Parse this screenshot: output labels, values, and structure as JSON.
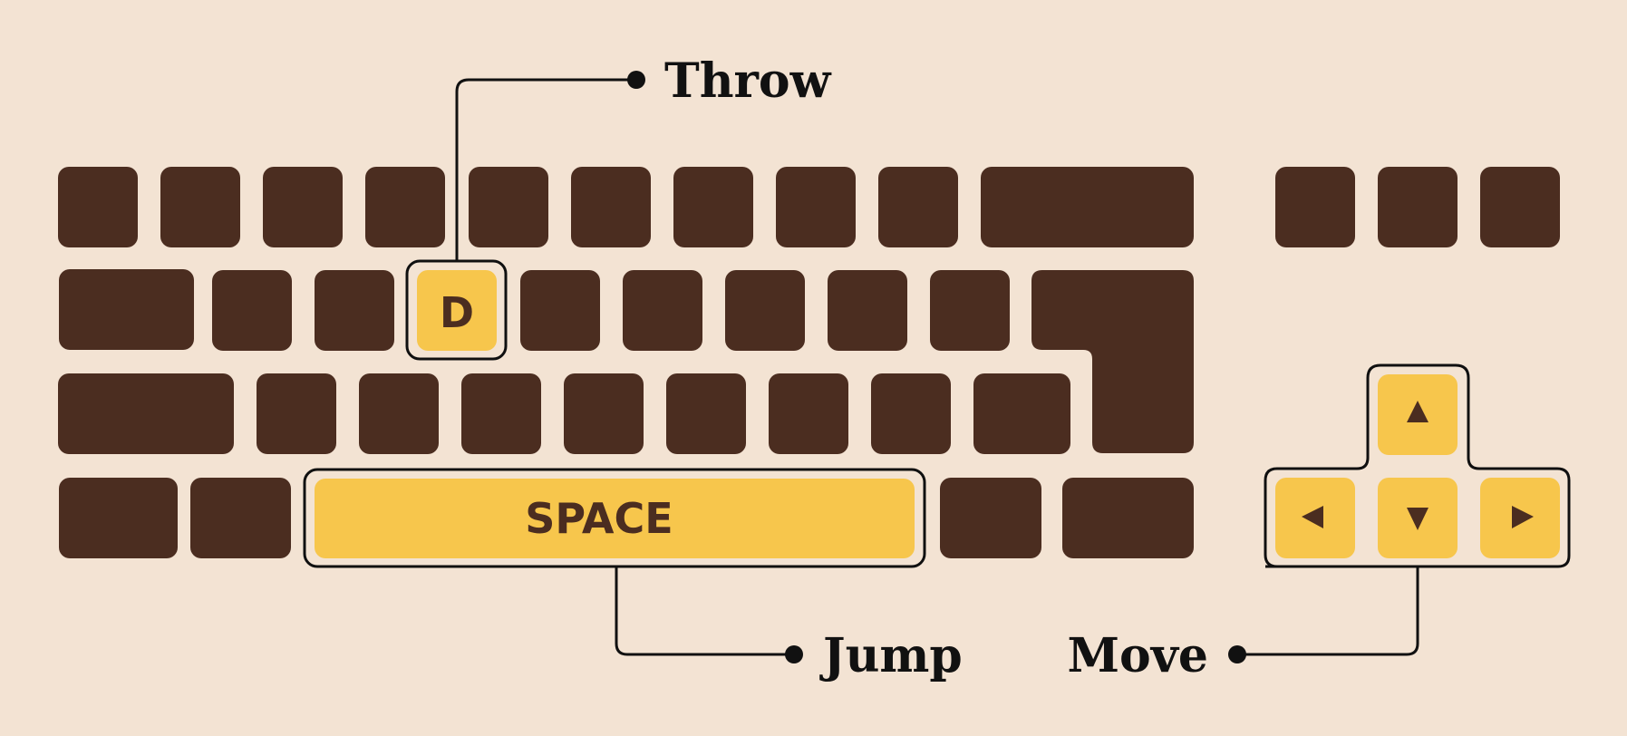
{
  "colors": {
    "background": "#f3e3d3",
    "key": "#4b2d20",
    "highlight_key": "#f7c64c",
    "outline": "#101010"
  },
  "highlighted_keys": {
    "d_key": "D",
    "space_key": "SPACE",
    "arrow_keys": [
      "up-arrow-icon",
      "left-arrow-icon",
      "down-arrow-icon",
      "right-arrow-icon"
    ]
  },
  "callouts": {
    "throw": "Throw",
    "jump": "Jump",
    "move": "Move"
  }
}
